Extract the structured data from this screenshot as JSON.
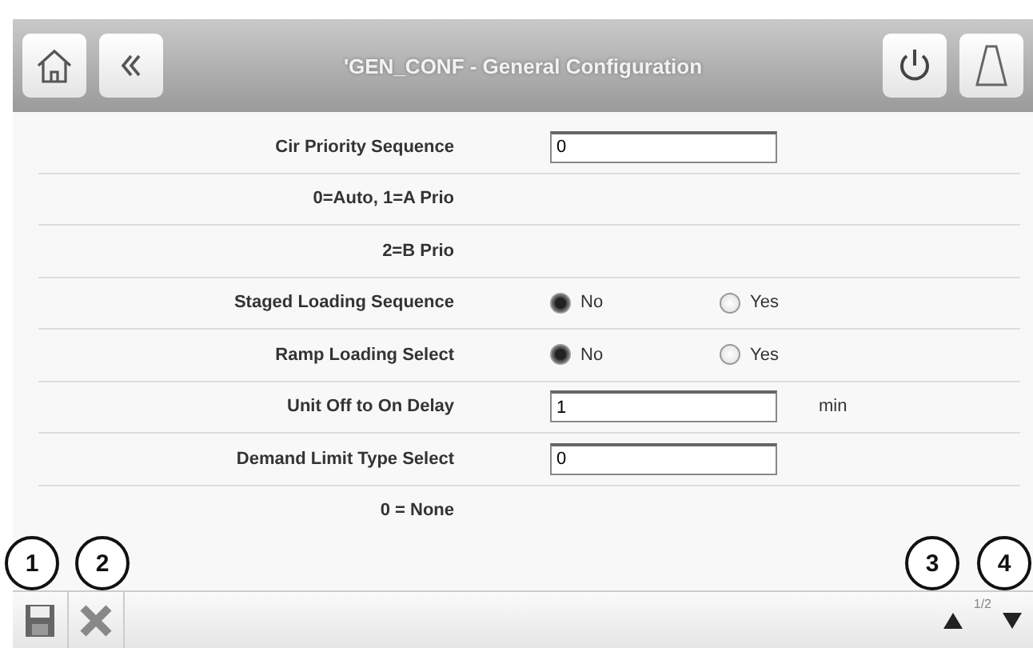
{
  "header": {
    "title": "'GEN_CONF - General Configuration"
  },
  "rows": [
    {
      "kind": "field",
      "label": "Cir Priority Sequence",
      "value": "0"
    },
    {
      "kind": "note",
      "label": "0=Auto,   1=A Prio"
    },
    {
      "kind": "note",
      "label": "2=B Prio"
    },
    {
      "kind": "radio",
      "label": "Staged Loading Sequence",
      "options": [
        {
          "label": "No",
          "selected": true
        },
        {
          "label": "Yes",
          "selected": false
        }
      ]
    },
    {
      "kind": "radio",
      "label": "Ramp Loading Select",
      "options": [
        {
          "label": "No",
          "selected": true
        },
        {
          "label": "Yes",
          "selected": false
        }
      ]
    },
    {
      "kind": "field",
      "label": "Unit Off to On Delay",
      "value": "1",
      "unit": "min"
    },
    {
      "kind": "field",
      "label": "Demand Limit Type Select",
      "value": "0"
    },
    {
      "kind": "note",
      "label": "0 = None"
    }
  ],
  "footer": {
    "page": "1/2"
  },
  "callouts": [
    "1",
    "2",
    "3",
    "4"
  ]
}
